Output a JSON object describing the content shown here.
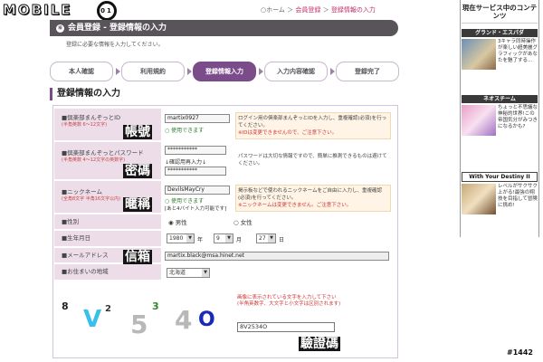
{
  "logo": {
    "text": "MOBILE",
    "ring": "01"
  },
  "breadcrumb": {
    "home": "○ホーム",
    "sep1": "＞",
    "member": "会員登録",
    "sep2": "＞",
    "current": "登録情報の入力"
  },
  "title_bar": {
    "icon": "⑥",
    "text": "会員登録 ‐ 登録情報の入力"
  },
  "subtext": "登録に必要な情報を入力してください。",
  "steps": [
    {
      "label": "本人確認",
      "active": false
    },
    {
      "label": "利用規約",
      "active": false
    },
    {
      "label": "登録情報入力",
      "active": true
    },
    {
      "label": "入力内容確認",
      "active": false
    },
    {
      "label": "登録完了",
      "active": false
    }
  ],
  "section_title": "登録情報の入力",
  "fields": {
    "id": {
      "label": "■倶楽部まんぞっとID",
      "sub": "(半角英数 6〜12文字)",
      "value": "martix0927",
      "status": "使用できます",
      "zh": "帳號",
      "note": "ログイン用の倶楽部まんぞっとIDを入力し、重複確認(必須)を行ってください。",
      "warn": "※IDは変更できませんので、ご注意下さい。"
    },
    "password": {
      "label": "■倶楽部まんぞっとパスワード",
      "sub": "(半角英数 4〜12文字の英数字)",
      "value": "***********",
      "confirm_label": "↓確認用再入力↓",
      "confirm_value": "***********",
      "zh": "密碼",
      "note": "パスワードは大切な情報ですので、簡単に推測できるものは避けてください。"
    },
    "nickname": {
      "label": "■ニックネーム",
      "sub": "(全角8文字 半角16文字以内)",
      "value": "DevilsMayCry",
      "status": "使用できます",
      "status2": "[あと4バイト入力可能です]",
      "zh": "暱稱",
      "note": "掲示板などで使われるニックネームをご自由に入力し、重複確認(必須)を行ってください。",
      "warn": "※ニックネームは変更できません。ご注意下さい。"
    },
    "gender": {
      "label": "■性別",
      "male": "男性",
      "female": "女性",
      "selected": "male"
    },
    "birthday": {
      "label": "■生年月日",
      "year": "1980",
      "year_unit": "年",
      "month": "9",
      "month_unit": "月",
      "day": "27",
      "day_unit": "日"
    },
    "email": {
      "label": "■メールアドレス",
      "value": "martix.black@msa.hinet.net",
      "zh": "信箱"
    },
    "region": {
      "label": "■お住まいの地域",
      "value": "北海道"
    }
  },
  "captcha": {
    "chars": [
      "8",
      "V",
      "2",
      "5",
      "3",
      "4",
      "O"
    ],
    "hint": "画像に表示されている文字を入力して下さい",
    "hint2": "(半角英数字、大文字と小文字は区別されます)",
    "value": "8V2534O",
    "zh": "驗證碼"
  },
  "sidebar": {
    "header": "現在サービス中のコンテンツ",
    "ads": [
      {
        "title": "グランド・エスパダ",
        "text": "3キャラ同時操作が楽しい超美麗グラフィックがあなたを魅了する…"
      },
      {
        "title": "ネオスチーム",
        "text": "ちょっと不思議な神秘的世界!この帝国気分がみつきになるかも?"
      },
      {
        "title": "With Your Destiny II",
        "text": "レベルがサクサク上がる!最強の翔技を目指して冒険に挑め!"
      }
    ]
  },
  "watermark": "#1442",
  "colors": {
    "accent": "#7a4d8a",
    "title_bar": "#58545a",
    "label_bg": "#ecdde9"
  }
}
